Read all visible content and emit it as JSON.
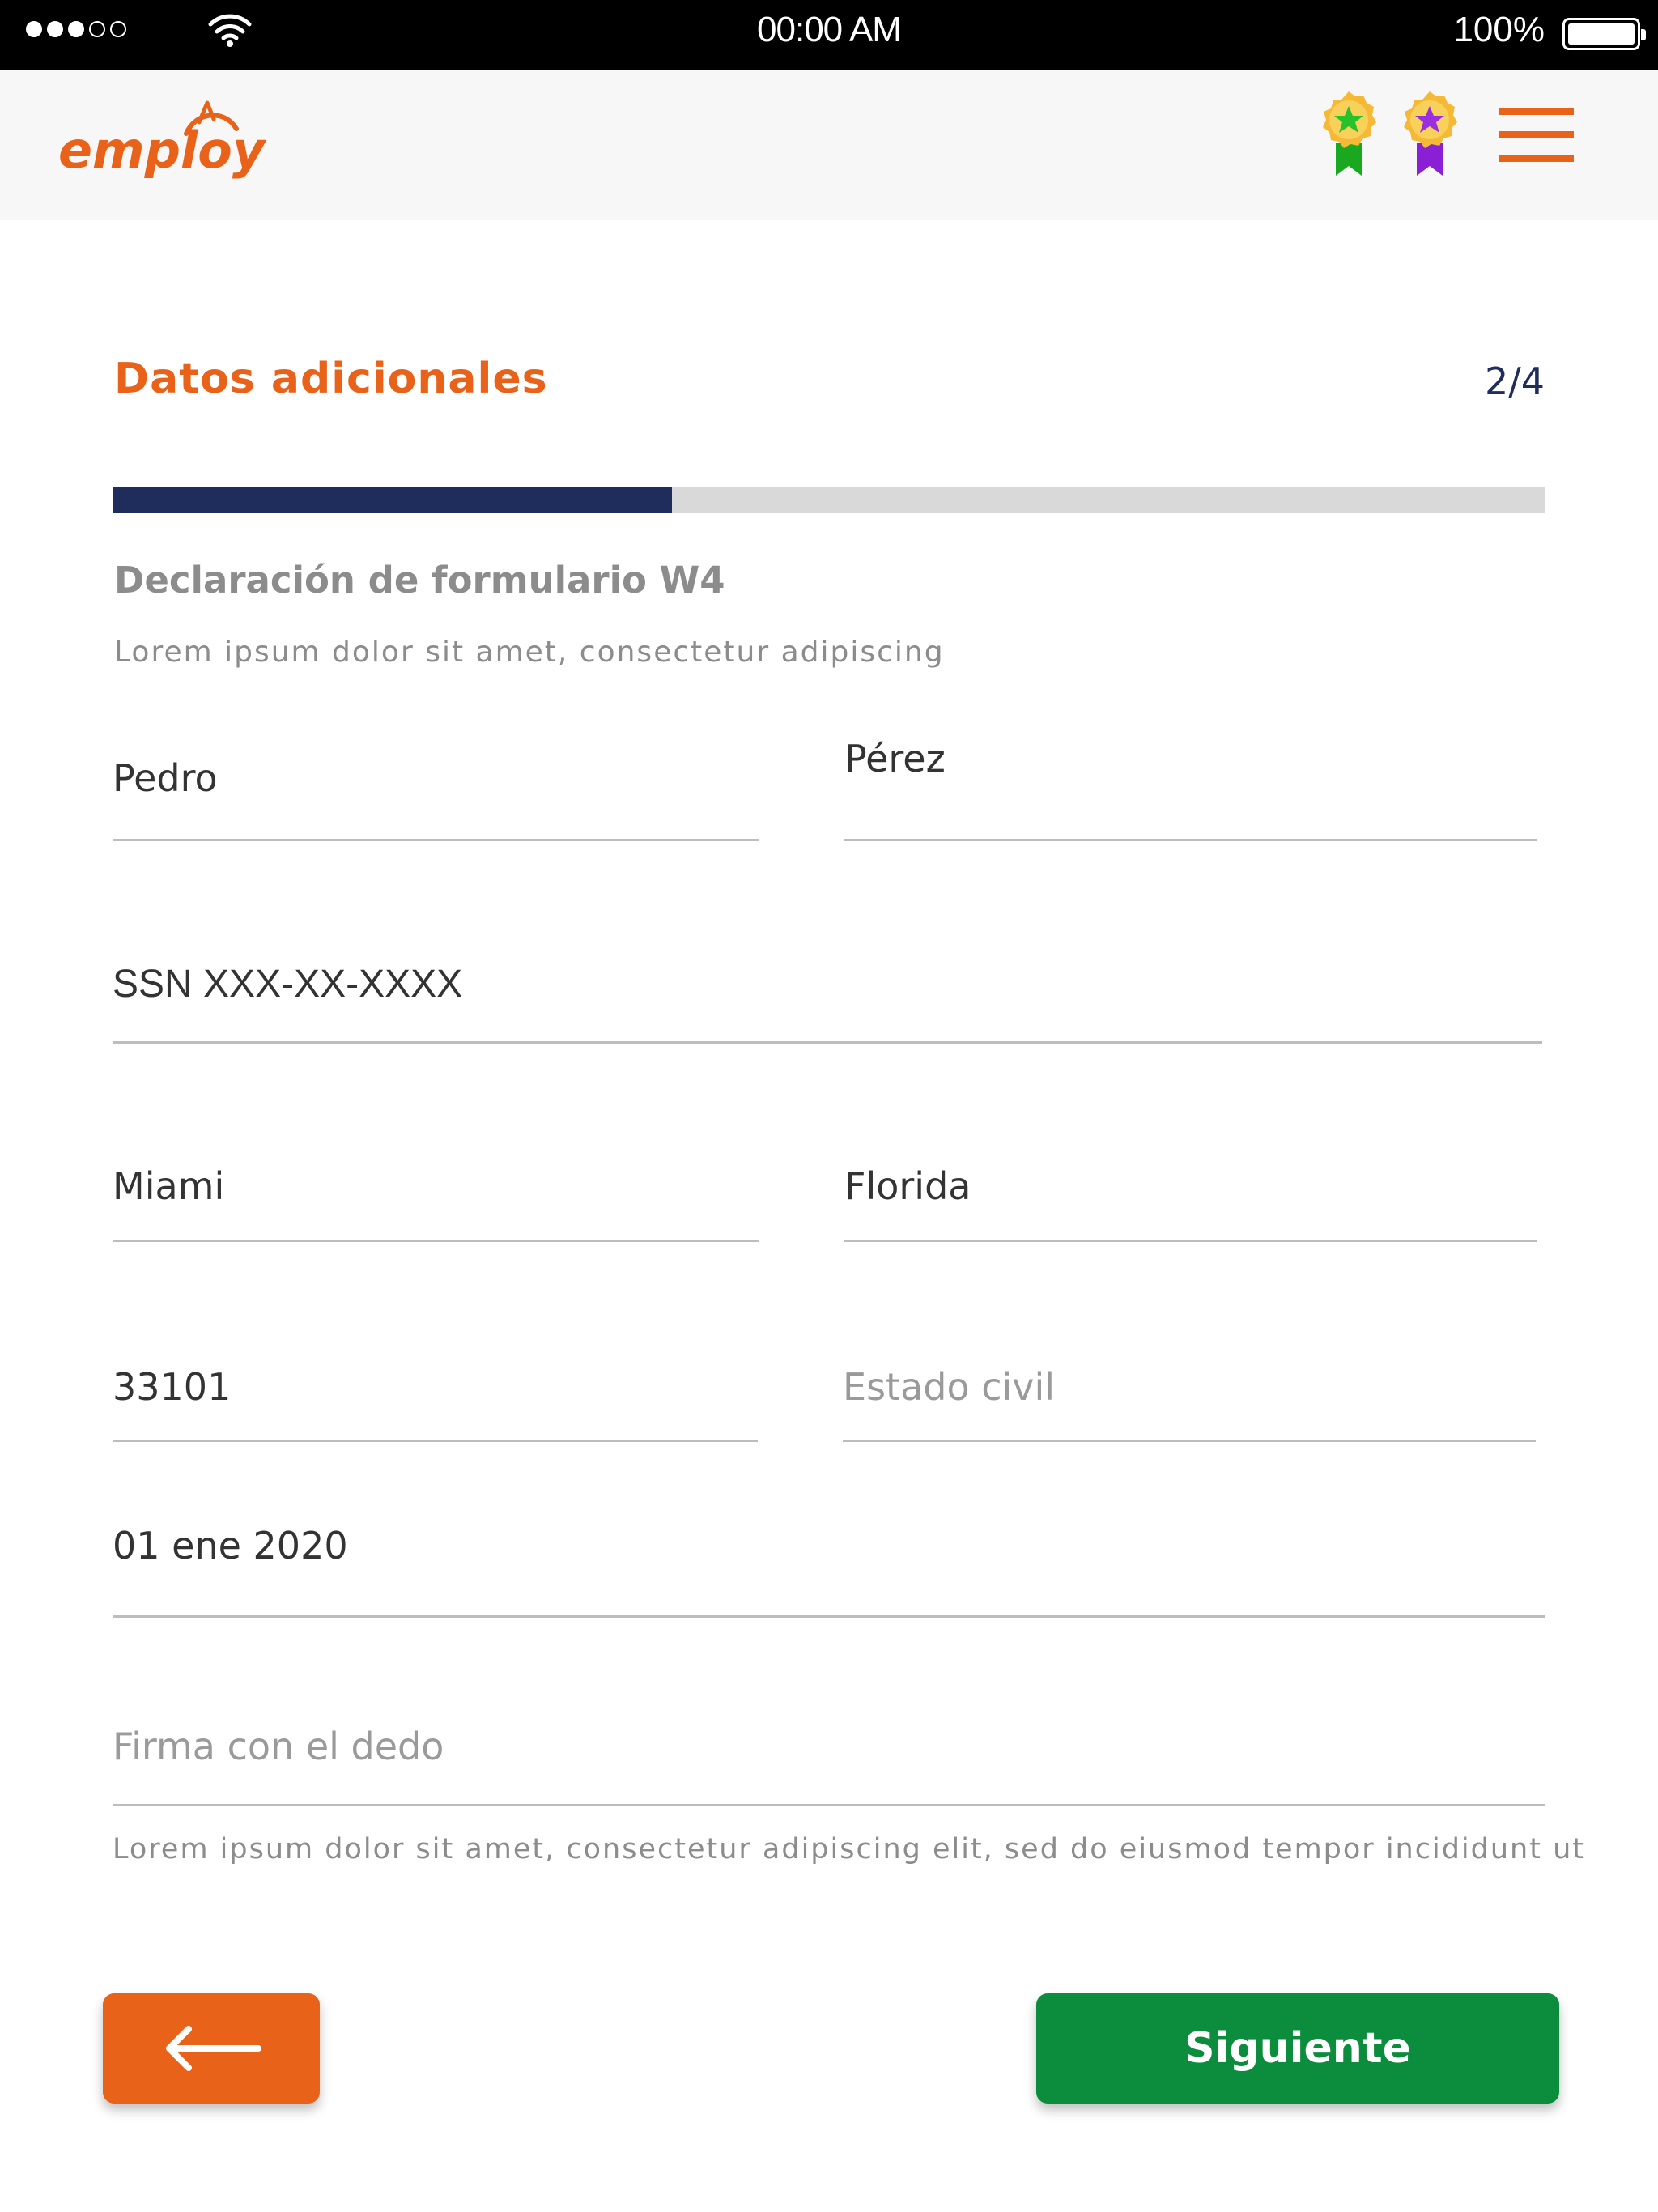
{
  "status_bar": {
    "time": "00:00 AM",
    "battery": "100%"
  },
  "header": {
    "logo_text": "employ",
    "badges": [
      {
        "name": "green-star-badge",
        "star_color": "#27c12c",
        "ribbon_color": "#19a81f"
      },
      {
        "name": "purple-star-badge",
        "star_color": "#9b2ee0",
        "ribbon_color": "#8a1fd6"
      }
    ],
    "menu_icon": "hamburger-icon"
  },
  "form": {
    "section_title": "Datos adicionales",
    "step": "2/4",
    "progress": 0.39,
    "title": "Declaración de formulario W4",
    "subtitle": "Lorem ipsum dolor sit amet, consectetur adipiscing",
    "first_name": "Pedro",
    "last_name": "Pérez",
    "ssn": "SSN XXX-XX-XXXX",
    "city": "Miami",
    "state": "Florida",
    "zip": "33101",
    "marital_status_placeholder": "Estado civil",
    "date": "01 ene 2020",
    "signature_placeholder": "Firma con el dedo",
    "helper_text": "Lorem ipsum dolor sit amet, consectetur adipiscing elit, sed do eiusmod tempor incididunt ut"
  },
  "buttons": {
    "next_label": "Siguiente"
  },
  "colors": {
    "brand_orange": "#e8621a",
    "navy": "#1f2d5c",
    "next_green": "#0b8d3d"
  }
}
